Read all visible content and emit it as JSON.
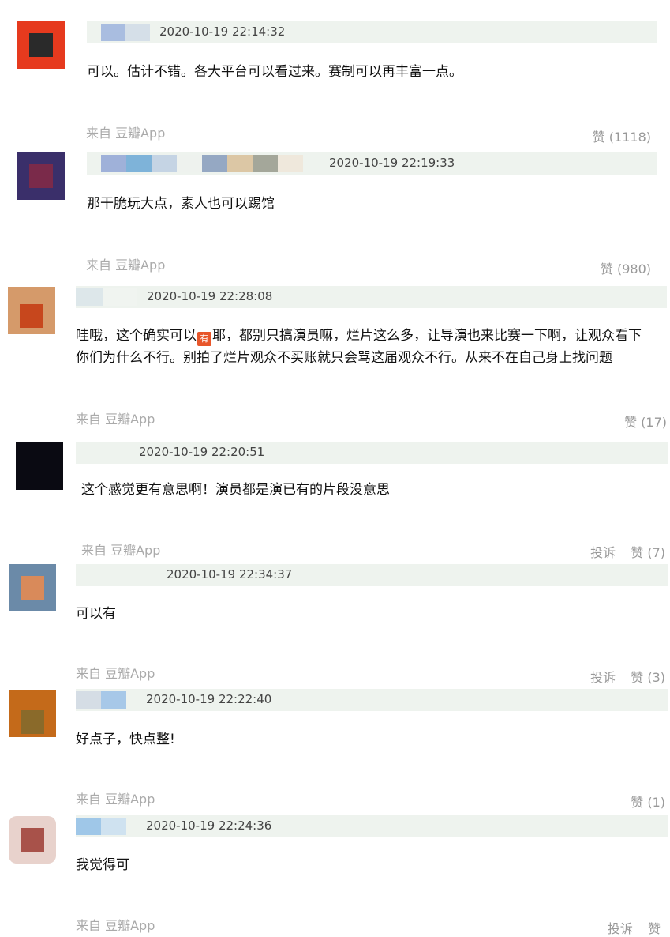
{
  "comments": [
    {
      "timestamp": "2020-10-19 22:14:32",
      "text": "可以。估计不错。各大平台可以看过来。赛制可以再丰富一点。",
      "source": "来自 豆瓣App",
      "like": "赞 (1118)",
      "avatar_bg": "#e63a1e",
      "avatar_fg": "#2a2a2a",
      "name_blocks": [
        "#a9bde0",
        "#d5dfe8"
      ]
    },
    {
      "timestamp": "2020-10-19 22:19:33",
      "text": "那干脆玩大点，素人也可以踢馆",
      "source": "来自 豆瓣App",
      "like": "赞 (980)",
      "avatar_bg": "#3a2f6a",
      "avatar_fg": "#7a2a4a",
      "name_blocks": [
        "#9fb1d9",
        "#7eb3d9",
        "#c5d4e4",
        "#eef2ee",
        "#95a8c3",
        "#dcc7a5",
        "#a4a79a",
        "#efe8dc"
      ]
    },
    {
      "timestamp": "2020-10-19 22:28:08",
      "text_parts": [
        "哇哦，这个确实可以",
        "耶，都别只搞演员嘛，烂片这么多，让导演也来比赛一下啊，让观众看下"
      ],
      "badge": "有",
      "text_line2": "你们为什么不行。别拍了烂片观众不买账就只会骂这届观众不行。从来不在自己身上找问题",
      "source": "来自 豆瓣App",
      "like": "赞 (17)",
      "avatar_bg": "#d59a6a",
      "avatar_fg": "#c7471d",
      "name_blocks": [
        "#dde7ea",
        "#f0f4f0"
      ]
    },
    {
      "timestamp": "2020-10-19 22:20:51",
      "text": "这个感觉更有意思啊！演员都是演已有的片段没意思",
      "source": "来自 豆瓣App",
      "report": "投诉",
      "like": "赞 (7)",
      "avatar_bg": "#0a0a12",
      "avatar_fg": "#0a0a12",
      "name_blocks": [
        "#eef3ee"
      ]
    },
    {
      "timestamp": "2020-10-19 22:34:37",
      "text": "可以有",
      "source": "来自 豆瓣App",
      "report": "投诉",
      "like": "赞 (3)",
      "avatar_bg": "#6b8aa8",
      "avatar_fg": "#d98a5a",
      "name_blocks": [
        "#eef3ee"
      ]
    },
    {
      "timestamp": "2020-10-19 22:22:40",
      "text": "好点子，快点整!",
      "source": "来自 豆瓣App",
      "like": "赞 (1)",
      "avatar_bg": "#c46a1a",
      "avatar_fg": "#8a6a2a",
      "name_blocks": [
        "#d5dde5",
        "#a7c8e8"
      ]
    },
    {
      "timestamp": "2020-10-19 22:24:36",
      "text": "我觉得可",
      "source": "来自 豆瓣App",
      "report": "投诉",
      "like": "赞",
      "avatar_bg": "#e8d2cc",
      "avatar_fg": "#a8524a",
      "name_blocks": [
        "#9fc7e8",
        "#cfe2f0"
      ]
    }
  ]
}
